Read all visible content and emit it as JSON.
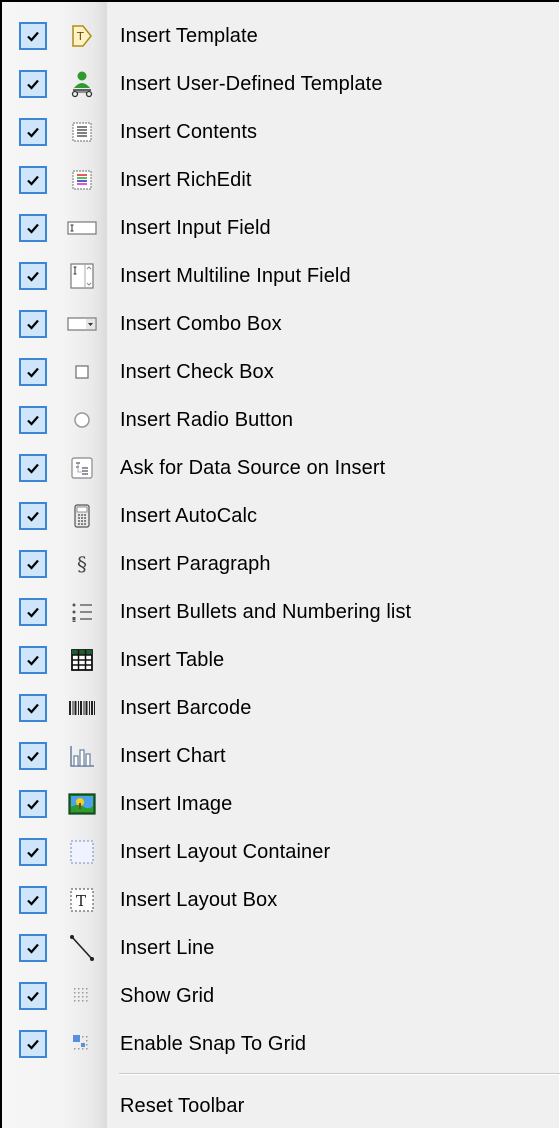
{
  "menu": {
    "items": [
      {
        "label": "Insert Template",
        "icon": "template-icon",
        "checked": true
      },
      {
        "label": "Insert User-Defined Template",
        "icon": "user-defined-template-icon",
        "checked": true
      },
      {
        "label": "Insert Contents",
        "icon": "contents-icon",
        "checked": true
      },
      {
        "label": "Insert RichEdit",
        "icon": "richedit-icon",
        "checked": true
      },
      {
        "label": "Insert Input Field",
        "icon": "input-field-icon",
        "checked": true
      },
      {
        "label": "Insert Multiline Input Field",
        "icon": "multiline-input-field-icon",
        "checked": true
      },
      {
        "label": "Insert Combo Box",
        "icon": "combo-box-icon",
        "checked": true
      },
      {
        "label": "Insert Check Box",
        "icon": "check-box-icon",
        "checked": true
      },
      {
        "label": "Insert Radio Button",
        "icon": "radio-button-icon",
        "checked": true
      },
      {
        "label": "Ask for Data Source on Insert",
        "icon": "data-source-icon",
        "checked": true
      },
      {
        "label": "Insert AutoCalc",
        "icon": "autocalc-icon",
        "checked": true
      },
      {
        "label": "Insert Paragraph",
        "icon": "paragraph-icon",
        "checked": true
      },
      {
        "label": "Insert Bullets and Numbering list",
        "icon": "bullets-numbering-icon",
        "checked": true
      },
      {
        "label": "Insert Table",
        "icon": "table-icon",
        "checked": true
      },
      {
        "label": "Insert Barcode",
        "icon": "barcode-icon",
        "checked": true
      },
      {
        "label": "Insert Chart",
        "icon": "chart-icon",
        "checked": true
      },
      {
        "label": "Insert Image",
        "icon": "image-icon",
        "checked": true
      },
      {
        "label": "Insert Layout Container",
        "icon": "layout-container-icon",
        "checked": true
      },
      {
        "label": "Insert Layout Box",
        "icon": "layout-box-icon",
        "checked": true
      },
      {
        "label": "Insert Line",
        "icon": "line-icon",
        "checked": true
      },
      {
        "label": "Show Grid",
        "icon": "grid-icon",
        "checked": true
      },
      {
        "label": "Enable Snap To Grid",
        "icon": "snap-to-grid-icon",
        "checked": true
      }
    ],
    "reset_label": "Reset Toolbar"
  },
  "colors": {
    "check_border": "#3b87d6",
    "check_fill": "#cfe5fb",
    "menu_bg": "#f0f0f0"
  }
}
